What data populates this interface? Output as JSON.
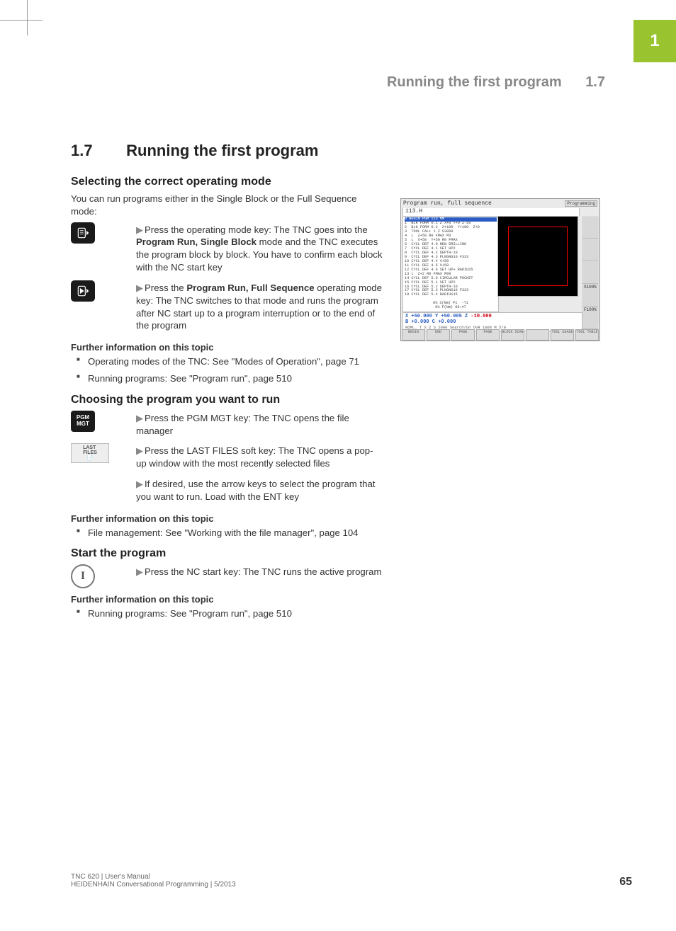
{
  "chapter_tab": "1",
  "running_head": {
    "title": "Running the first program",
    "section": "1.7"
  },
  "heading": {
    "number": "1.7",
    "title": "Running the first program"
  },
  "sec1": {
    "h2": "Selecting the correct operating mode",
    "intro": "You can run programs either in the Single Block or the Full Sequence mode:",
    "step1_pre": "Press the operating mode key: The TNC goes into the ",
    "step1_bold": "Program Run, Single Block",
    "step1_post": " mode and the TNC executes the program block by block. You have to confirm each block with the NC start key",
    "step2_pre": "Press the ",
    "step2_bold": "Program Run, Full Sequence",
    "step2_post": " operating mode key: The TNC switches to that mode and runs the program after NC start up to a program interruption or to the end of the program",
    "more_h": "Further information on this topic",
    "more1": "Operating modes of the TNC: See \"Modes of Operation\", page 71",
    "more2": "Running programs: See \"Program run\", page 510"
  },
  "sec2": {
    "h2": "Choosing the program you want to run",
    "pgm_key": "PGM\nMGT",
    "last_key": "LAST\nFILES",
    "step1": "Press the PGM MGT key: The TNC opens the file manager",
    "step2": "Press the LAST FILES soft key: The TNC opens a pop-up window with the most recently selected files",
    "step3": "If desired, use the arrow keys to select the program that you want to run. Load with the ENT key",
    "more_h": "Further information on this topic",
    "more1": "File management: See \"Working with the file manager\", page 104"
  },
  "sec3": {
    "h2": "Start the program",
    "nc_key": "I",
    "step1": "Press the NC start key: The TNC runs the active program",
    "more_h": "Further information on this topic",
    "more1": "Running programs: See \"Program run\", page 510"
  },
  "screenshot": {
    "title_left": "Program run, full sequence",
    "title_right": "Programming",
    "file": "113.H",
    "prog_hl": "0 BEGIN PGM 113 MM",
    "prog_lines": "1  BLK FORM 0.1 Z X+0 Y+0 Z-20\n2  BLK FORM 0.2  X+100  Y+100  Z+0\n3  TOOL CALL 1 Z S3000\n4  L  Z+50 R0 FMAX M3\n5  L  X+50  Y+50 R0 FMAX\n6  CYCL DEF 4.0 NEW DRILLING\n7  CYCL DEF 4.1 SET UP2\n8  CYCL DEF 4.2 DEPTH-10\n9  CYCL DEF 4.3 PLNGNG10 F333\n10 CYCL DEF 4.4 V+50\n11 CYCL DEF 4.5 V+50\n12 CYCL DEF 4.6 SET UP+ RADIUS5\n13 L  Z+2 R0 FMAX M99\n14 CYCL DEF 5.0 CIRCULAR POCKET\n15 CYCL DEF 5.1 SET UP2\n16 CYCL DEF 5.2 DEPTH-10\n17 CYCL DEF 5.3 PLNGNG10 F333\n18 CYCL DEF 5.4 RADIUS15",
    "info_line": "0% S(Nm) P1  -T1\n0% F(Nm) 09:47",
    "coord_line1": "X  +50.000  Y   +50.005  Z   ",
    "coord_z": "-10.000",
    "coord_line2": "B   +0.000  C    +0.000",
    "side_s100": "S100%",
    "side_f100": "F100%",
    "status_line": "NOML.             T     S 2 S   2000           Search/Un   OVR  100%  M 5/9",
    "softkeys": [
      "BEGIN",
      "END",
      "PAGE",
      "PAGE",
      "BLOCK SCAN",
      "",
      "TOOL USAGE",
      "TOOL TABLE"
    ]
  },
  "footer": {
    "line1": "TNC 620 | User's Manual",
    "line2": "HEIDENHAIN Conversational Programming | 5/2013",
    "page": "65"
  }
}
